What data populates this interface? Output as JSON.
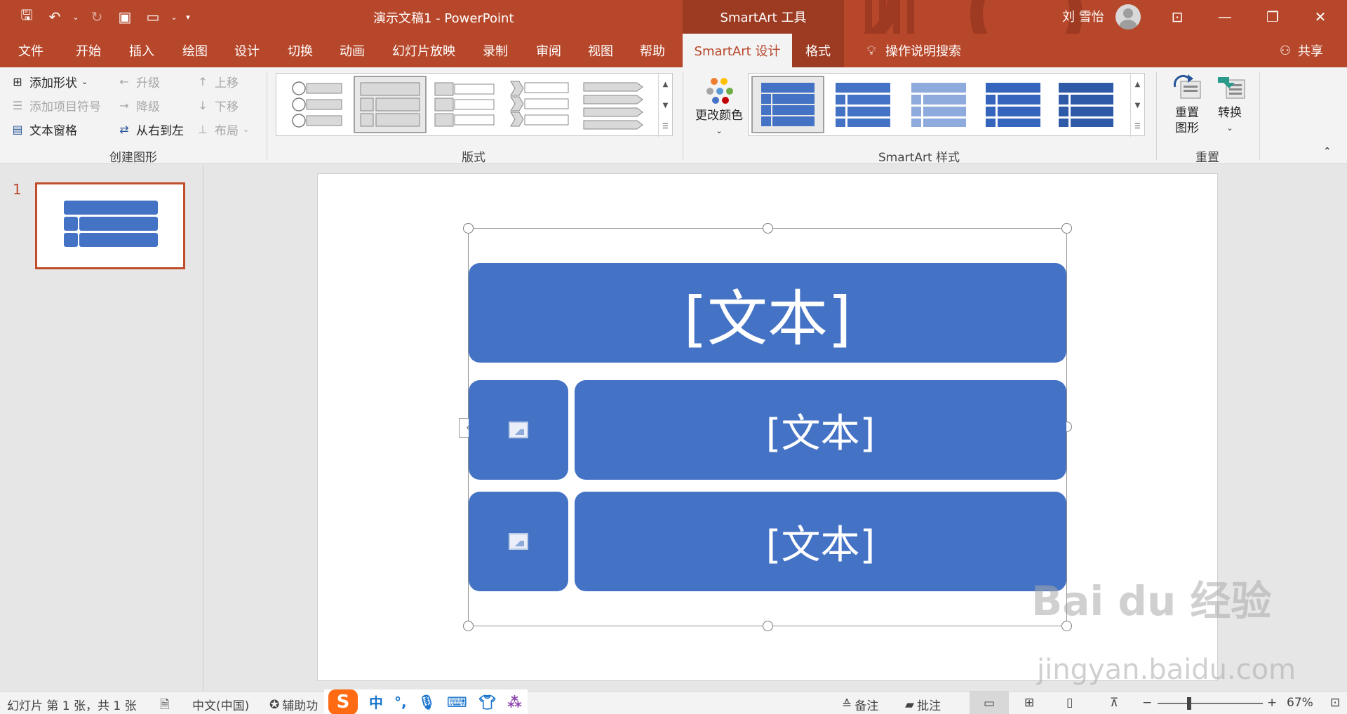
{
  "titlebar": {
    "document_title": "演示文稿1  -  PowerPoint",
    "context_tools": "SmartArt 工具",
    "user_name": "刘 雪怡"
  },
  "tabs": [
    "文件",
    "开始",
    "插入",
    "绘图",
    "设计",
    "切换",
    "动画",
    "幻灯片放映",
    "录制",
    "审阅",
    "视图",
    "帮助",
    "SmartArt 设计",
    "格式",
    "操作说明搜索",
    "共享"
  ],
  "ribbon": {
    "create_graphic": {
      "label": "创建图形",
      "add_shape": "添加形状",
      "add_bullet": "添加项目符号",
      "text_pane": "文本窗格",
      "promote": "升级",
      "demote": "降级",
      "right_to_left": "从右到左",
      "move_up": "上移",
      "move_down": "下移",
      "layout": "布局"
    },
    "layouts": {
      "label": "版式"
    },
    "styles": {
      "label": "SmartArt 样式",
      "change_colors": "更改颜色"
    },
    "reset": {
      "label": "重置",
      "reset_graphic_1": "重置",
      "reset_graphic_2": "图形",
      "convert": "转换"
    }
  },
  "thumbnails": {
    "slide_number": "1"
  },
  "slide": {
    "smartart": {
      "top_text": "[文本]",
      "row1_text": "[文本]",
      "row2_text": "[文本]"
    }
  },
  "watermark": {
    "line1": "Bai du 经验",
    "line2": "jingyan.baidu.com"
  },
  "statusbar": {
    "slide_info": "幻灯片 第 1 张，共 1 张",
    "language": "中文(中国)",
    "accessibility": "辅助功",
    "ime_mode": "中",
    "notes": "备注",
    "comments": "批注",
    "zoom": "67%"
  },
  "colors": {
    "accent": "#b7472a",
    "smartart_blue": "#4472c4"
  }
}
